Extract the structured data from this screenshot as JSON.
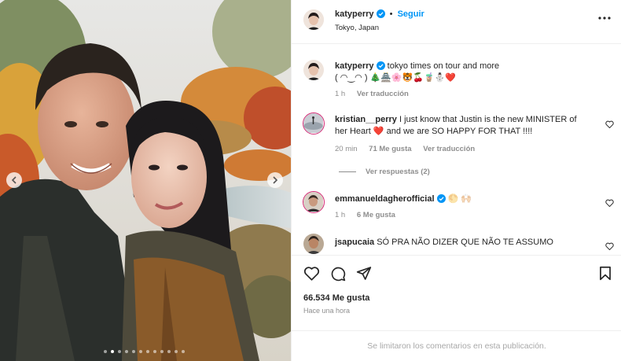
{
  "post": {
    "author": "katyperry",
    "follow_label": "Seguir",
    "separator": "•",
    "location": "Tokyo, Japan",
    "more_icon": "more-horizontal-icon"
  },
  "caption": {
    "username": "katyperry",
    "text": "tokyo times on tour and more",
    "text_line2": "( ◠‿◠ ) 🎄🏯🌸🐯🍒🧋⛄️❤️",
    "time": "1 h",
    "translate": "Ver traducción"
  },
  "comments": [
    {
      "username": "kristian__perry",
      "text": "I just know that Justin is the new MINISTER of",
      "text_line2": "her Heart ❤️ and we are SO HAPPY FOR THAT !!!!",
      "time": "20 min",
      "likes": "71 Me gusta",
      "translate": "Ver traducción",
      "replies": "Ver respuestas (2)"
    },
    {
      "username": "emmanueldagherofficial",
      "text": "🌕 🙌🏻",
      "time": "1 h",
      "likes": "6 Me gusta"
    },
    {
      "username": "jsapucaia",
      "text": "SÓ PRA NÃO DIZER QUE NÃO TE ASSUMO"
    }
  ],
  "stats": {
    "likes": "66.534 Me gusta",
    "time": "Hace una hora"
  },
  "footer": {
    "text": "Se limitaron los comentarios en esta publicación."
  },
  "carousel": {
    "total": 12,
    "active_index": 1
  },
  "colors": {
    "link": "#0095f6",
    "heart": "#ed4956",
    "verified": "#0095f6",
    "muted": "#8e8e8e"
  }
}
